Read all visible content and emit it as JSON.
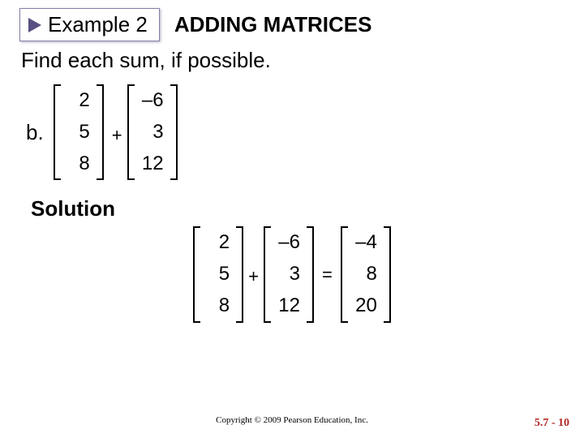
{
  "header": {
    "example_label": "Example 2",
    "title": "ADDING MATRICES"
  },
  "instruction": "Find each sum, if possible.",
  "part": {
    "label": "b.",
    "matrix_a": [
      "2",
      "5",
      "8"
    ],
    "plus": "+",
    "matrix_b": [
      "–6",
      "3",
      "12"
    ]
  },
  "solution": {
    "label": "Solution",
    "matrix_a": [
      "2",
      "5",
      "8"
    ],
    "plus": "+",
    "matrix_b": [
      "–6",
      "3",
      "12"
    ],
    "equals": "=",
    "matrix_c": [
      "–4",
      "8",
      "20"
    ]
  },
  "footer": {
    "copyright": "Copyright © 2009 Pearson Education, Inc.",
    "slide": "5.7 - 10"
  }
}
